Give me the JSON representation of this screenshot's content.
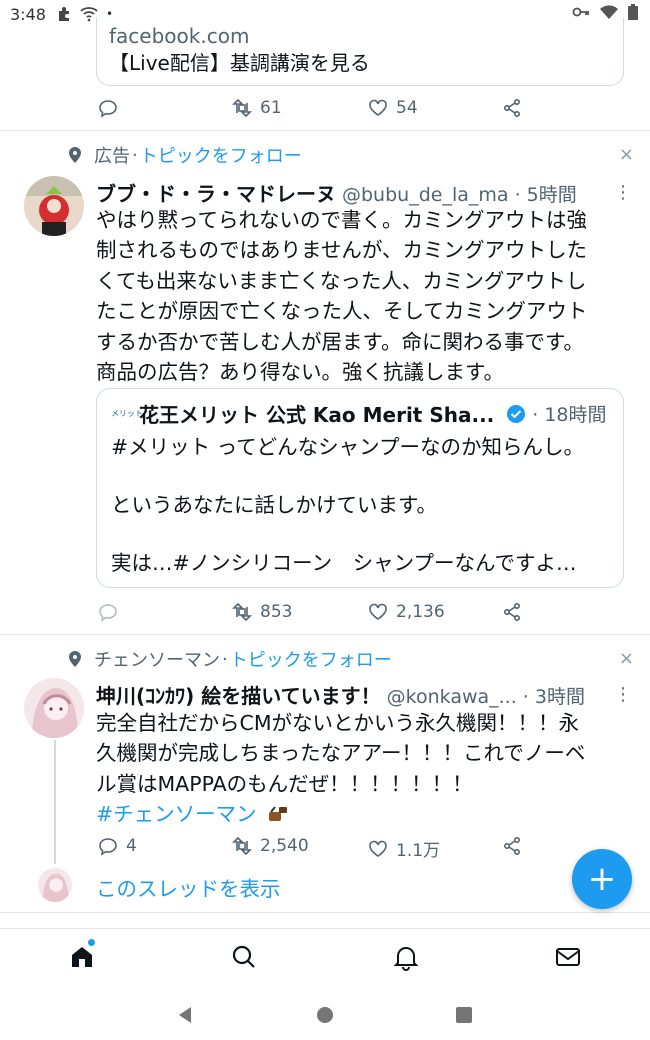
{
  "status_bar": {
    "time": "3:48"
  },
  "tweet0": {
    "card_domain": "facebook.com",
    "card_title": "【Live配信】基調講演を見る",
    "retweets": "61",
    "likes": "54"
  },
  "tweet1": {
    "context_label": "広告",
    "context_sep": "·",
    "context_follow": "トピックをフォロー",
    "dismiss": "×",
    "name": "ブブ・ド・ラ・マドレーヌ",
    "handle_time": "@bubu_de_la_ma · 5時間",
    "text_lines": [
      "やはり黙ってられないので書く。カミングアウトは強",
      "制されるものではありませんが、カミングアウトした",
      "くても出来ないまま亡くなった人、カミングアウトし",
      "たことが原因で亡くなった人、そしてカミングアウト",
      "するか否かで苦しむ人が居ます。命に関わる事です。",
      "商品の広告？あり得ない。強く抗議します。"
    ],
    "quote": {
      "logo_text": "メリット",
      "name": "花王メリット 公式 Kao Merit Sha...",
      "time": "· 18時間",
      "lines": [
        "#メリット ってどんなシャンプーなのか知らんし。",
        "",
        "というあなたに話しかけています。",
        "",
        "実は…#ノンシリコーン　シャンプーなんですよ…"
      ]
    },
    "retweets": "853",
    "likes": "2,136"
  },
  "tweet2": {
    "context_label": "チェンソーマン",
    "context_sep": "·",
    "context_follow": "トピックをフォロー",
    "dismiss": "×",
    "name": "坤川(ｺﾝｶﾜ) 絵を描いています！",
    "handle_time": "@konkawa_... · 3時間",
    "text_lines": [
      "完全自社だからCMがないとかいう永久機関！！！永",
      "久機関が完成しちまったなアアー！！！これでノーベ",
      "ル賞はMAPPAのもんだぜ！！！！！！！"
    ],
    "hashtag": "#チェンソーマン",
    "replies": "4",
    "retweets": "2,540",
    "likes": "1.1万",
    "show_thread": "このスレッドを表示"
  },
  "fab": {
    "label": "+"
  },
  "colors": {
    "accent": "#1d9bf0",
    "text": "#0f1419",
    "muted": "#536471"
  }
}
